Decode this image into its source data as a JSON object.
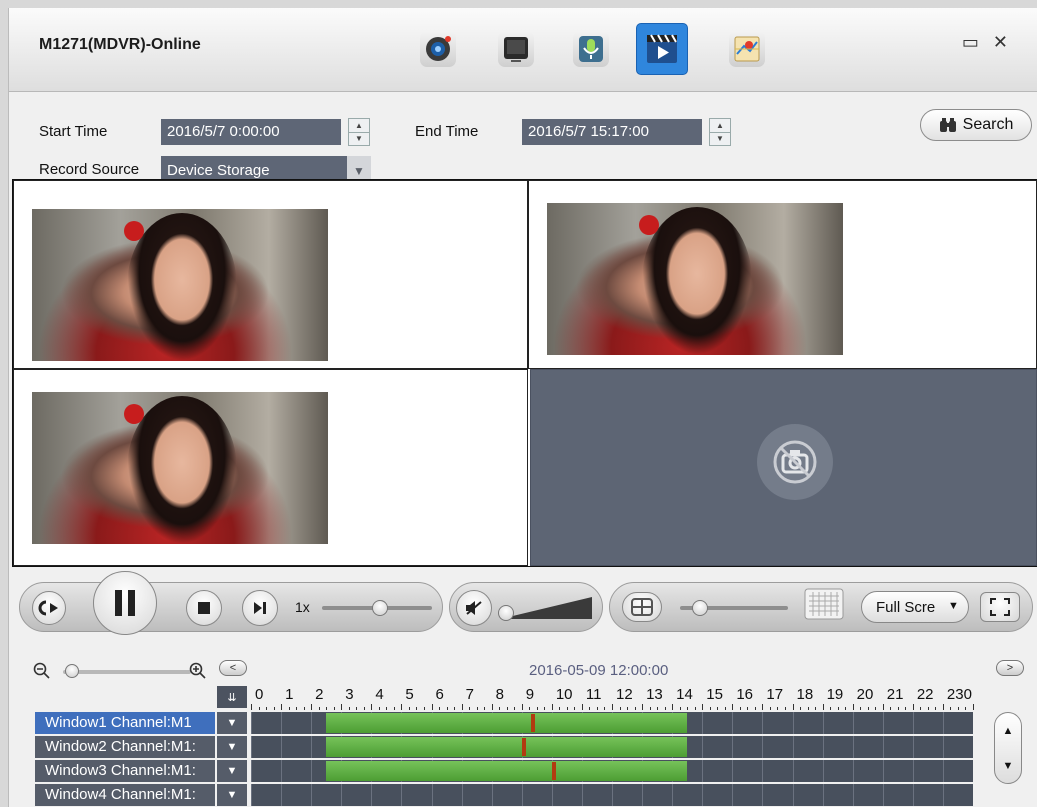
{
  "window": {
    "title": "M1271(MDVR)-Online",
    "toolbar_icons": [
      "camera-icon",
      "monitor-icon",
      "microphone-icon",
      "playback-icon",
      "map-icon"
    ],
    "active_icon": "playback-icon"
  },
  "search": {
    "start_label": "Start Time",
    "start_value": "2016/5/7 0:00:00",
    "end_label": "End Time",
    "end_value": "2016/5/7 15:17:00",
    "source_label": "Record Source",
    "source_value": "Device Storage",
    "search_label": "Search"
  },
  "playback": {
    "speed": "1x",
    "screen_mode": "Full Scre"
  },
  "timeline": {
    "date": "2016-05-09 12:00:00",
    "hours": [
      "0",
      "1",
      "2",
      "3",
      "4",
      "5",
      "6",
      "7",
      "8",
      "9",
      "10",
      "11",
      "12",
      "13",
      "14",
      "15",
      "16",
      "17",
      "18",
      "19",
      "20",
      "21",
      "22",
      "230"
    ],
    "channels": [
      {
        "label": "Window1 Channel:M1",
        "selected": true,
        "record_start": 2.5,
        "record_end": 14.5,
        "marker": 9.3
      },
      {
        "label": "Window2 Channel:M1:",
        "selected": false,
        "record_start": 2.5,
        "record_end": 14.5,
        "marker": 9.0
      },
      {
        "label": "Window3 Channel:M1:",
        "selected": false,
        "record_start": 2.5,
        "record_end": 14.5,
        "marker": 10.0
      },
      {
        "label": "Window4 Channel:M1:",
        "selected": false,
        "record_start": null,
        "record_end": null,
        "marker": null
      }
    ]
  },
  "colors": {
    "accent": "#2f86dd",
    "record": "#5aab3c",
    "marker": "#b23b10",
    "field_bg": "#5e6676"
  }
}
